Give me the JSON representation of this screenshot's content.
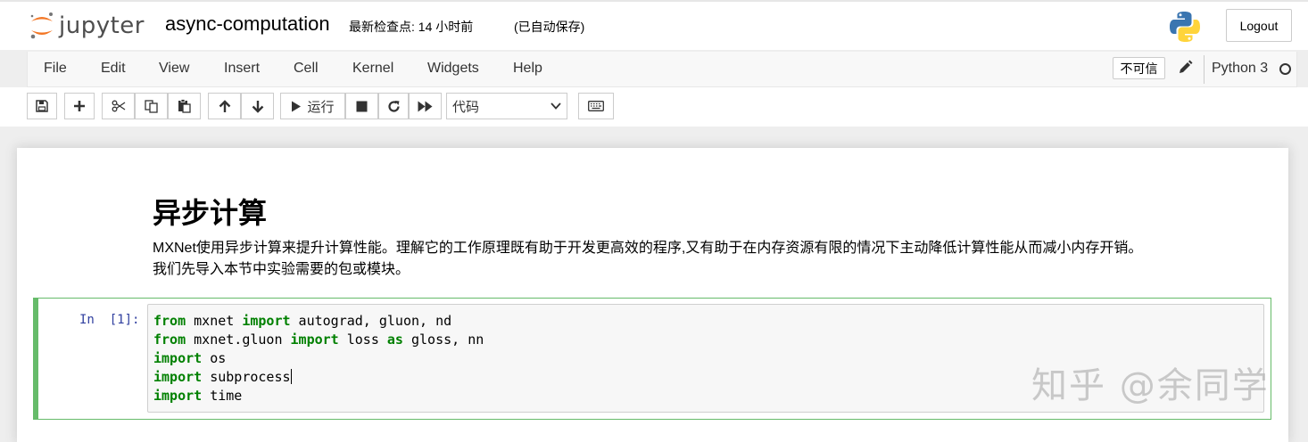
{
  "header": {
    "logo_text": "jupyter",
    "notebook_title": "async-computation",
    "checkpoint": "最新检查点: 14 小时前",
    "autosave": "(已自动保存)",
    "logout_label": "Logout"
  },
  "menubar": {
    "items": [
      "File",
      "Edit",
      "View",
      "Insert",
      "Cell",
      "Kernel",
      "Widgets",
      "Help"
    ],
    "trusted_label": "不可信",
    "kernel_name": "Python 3"
  },
  "toolbar": {
    "run_label": "运行",
    "cell_type": "代码",
    "cell_type_options": [
      "代码"
    ]
  },
  "notebook": {
    "heading": "异步计算",
    "paragraph_line1": "MXNet使用异步计算来提升计算性能。理解它的工作原理既有助于开发更高效的程序,又有助于在内存资源有限的情况下主动降低计算性能从而减小内存开销。",
    "paragraph_line2": "我们先导入本节中实验需要的包或模块。",
    "cell": {
      "prompt": "In  [1]:",
      "code_lines": [
        [
          {
            "t": "from",
            "k": true
          },
          {
            "t": " mxnet "
          },
          {
            "t": "import",
            "k": true
          },
          {
            "t": " autograd, gluon, nd"
          }
        ],
        [
          {
            "t": "from",
            "k": true
          },
          {
            "t": " mxnet.gluon "
          },
          {
            "t": "import",
            "k": true
          },
          {
            "t": " loss "
          },
          {
            "t": "as",
            "k": true
          },
          {
            "t": " gloss, nn"
          }
        ],
        [
          {
            "t": "import",
            "k": true
          },
          {
            "t": " os"
          }
        ],
        [
          {
            "t": "import",
            "k": true
          },
          {
            "t": " subprocess"
          }
        ],
        [
          {
            "t": "import",
            "k": true
          },
          {
            "t": " time"
          }
        ]
      ]
    }
  },
  "watermark": "知乎 @余同学",
  "colors": {
    "cell_border": "#66bb6a",
    "keyword": "#008000",
    "prompt": "#303f9f",
    "logo_orange": "#f37726"
  }
}
